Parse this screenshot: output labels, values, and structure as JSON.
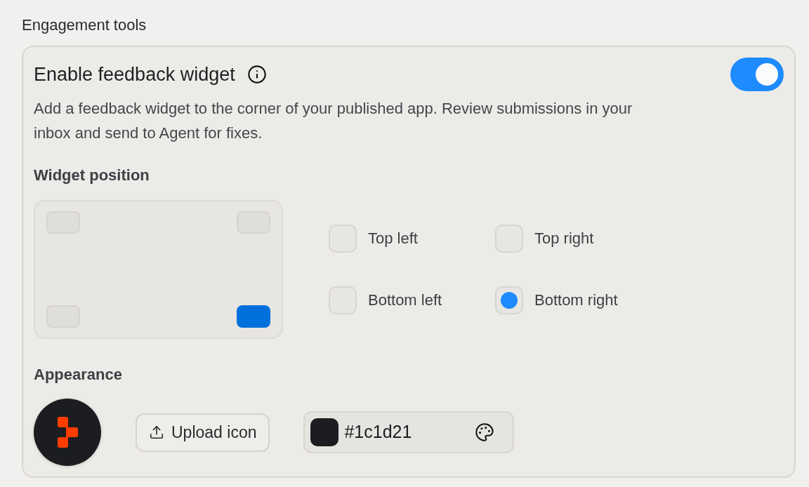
{
  "section_title": "Engagement tools",
  "feedback_widget": {
    "title": "Enable feedback widget",
    "on": true,
    "description": "Add a feedback widget to the corner of your published app. Review submissions in your inbox and send to Agent for fixes."
  },
  "widget_position": {
    "label": "Widget position",
    "options": [
      {
        "label": "Top left",
        "selected": false
      },
      {
        "label": "Top right",
        "selected": false
      },
      {
        "label": "Bottom left",
        "selected": false
      },
      {
        "label": "Bottom right",
        "selected": true
      }
    ]
  },
  "appearance": {
    "label": "Appearance",
    "upload_button": "Upload icon",
    "color_field": {
      "value": "#1c1d21",
      "color": "#1c1d21"
    }
  }
}
